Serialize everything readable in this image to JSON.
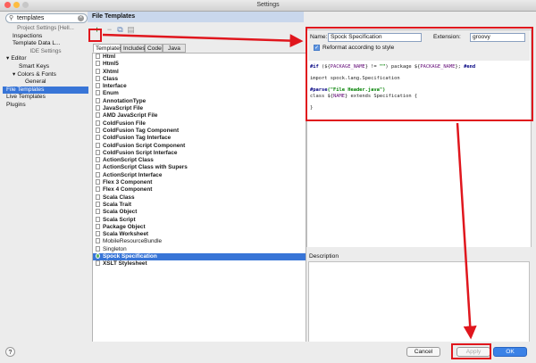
{
  "window": {
    "title": "Settings"
  },
  "search": {
    "value": "templates"
  },
  "sidebar": {
    "items": [
      {
        "label": "Project Settings [Hell...",
        "type": "header"
      },
      {
        "label": "Inspections",
        "type": "item",
        "indent": 1
      },
      {
        "label": "Template Data L...",
        "type": "item",
        "indent": 1
      },
      {
        "label": "IDE Settings",
        "type": "header"
      },
      {
        "label": "Editor",
        "type": "item",
        "indent": 0,
        "expand": "▾"
      },
      {
        "label": "Smart Keys",
        "type": "item",
        "indent": 2
      },
      {
        "label": "Colors & Fonts",
        "type": "item",
        "indent": 1,
        "expand": "▾"
      },
      {
        "label": "General",
        "type": "item",
        "indent": 3
      },
      {
        "label": "File Templates",
        "type": "item",
        "indent": 0,
        "selected": true
      },
      {
        "label": "Live Templates",
        "type": "item",
        "indent": 0
      },
      {
        "label": "Plugins",
        "type": "item",
        "indent": 0
      }
    ]
  },
  "panel": {
    "title": "File Templates",
    "tabs": [
      "Templates",
      "Includes",
      "Code",
      "Java EE"
    ],
    "active_tab": 0,
    "templates": [
      "Html",
      "Html5",
      "Xhtml",
      "Class",
      "Interface",
      "Enum",
      "AnnotationType",
      "JavaScript File",
      "AMD JavaScript File",
      "ColdFusion File",
      "ColdFusion Tag Component",
      "ColdFusion Tag Interface",
      "ColdFusion Script Component",
      "ColdFusion Script Interface",
      "ActionScript Class",
      "ActionScript Class with Supers",
      "ActionScript Interface",
      "Flex 3 Component",
      "Flex 4 Component",
      "Scala Class",
      "Scala Trait",
      "Scala Object",
      "Scala Script",
      "Package Object",
      "Scala Worksheet",
      "MobileResourceBundle",
      "Singleton",
      "Spock Specification",
      "XSLT Stylesheet"
    ],
    "plain_templates": [
      "MobileResourceBundle",
      "Singleton"
    ],
    "selected_template": "Spock Specification"
  },
  "editor": {
    "name_label": "Name:",
    "name_value": "Spock Specification",
    "extension_label": "Extension:",
    "extension_value": "groovy",
    "reformat_label": "Reformat according to style",
    "reformat_checked": true,
    "code": {
      "line1_if": "#if",
      "line1_open": " (${",
      "line1_var1": "PACKAGE_NAME",
      "line1_neq": "} != ",
      "line1_str": "\"\"",
      "line1_pkg": ") package ${",
      "line1_var2": "PACKAGE_NAME",
      "line1_end": "}; ",
      "line1_endkw": "#end",
      "line3": "import spock.lang.Specification",
      "line5_parse": "#parse",
      "line5_arg": "(\"File Header.java\")",
      "line6_pre": "class ${",
      "line6_var": "NAME",
      "line6_post": "} extends Specification {",
      "line8": "}"
    },
    "description_label": "Description"
  },
  "footer": {
    "help": "?",
    "cancel": "Cancel",
    "apply": "Apply",
    "ok": "OK"
  },
  "toolbar": {
    "add": "+",
    "remove": "−",
    "copy": "⧉",
    "reset": "▤"
  },
  "colors": {
    "annotation": "#e0161d",
    "selection": "#3875d7",
    "ok": "#3b82e6"
  }
}
